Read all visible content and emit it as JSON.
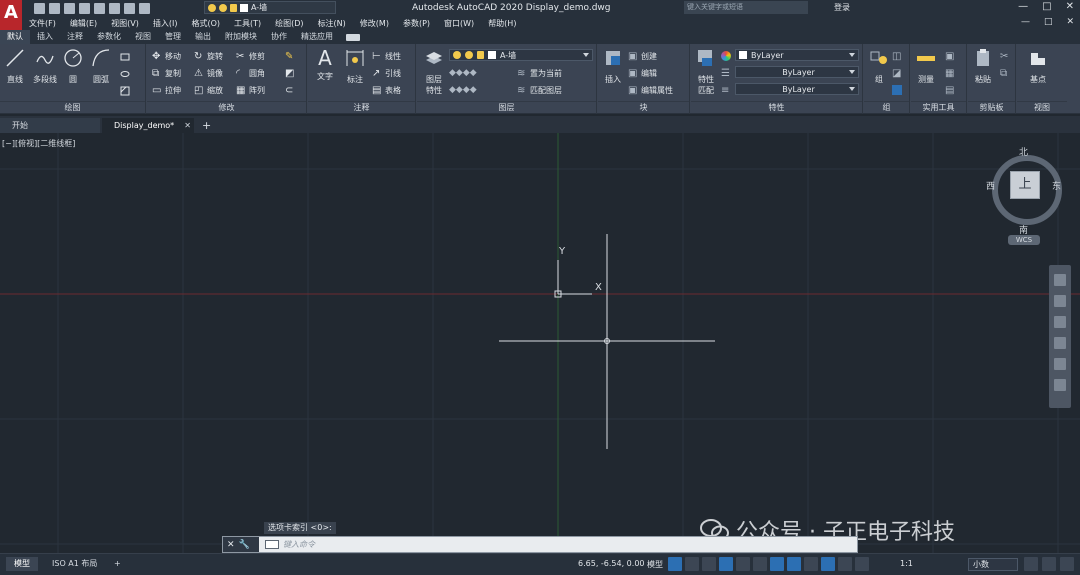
{
  "titlebar": {
    "app_logo": "A",
    "layer_name": "A-墙",
    "title": "Autodesk AutoCAD 2020    Display_demo.dwg",
    "search_placeholder": "键入关键字或短语",
    "login": "登录",
    "window_controls": [
      "—",
      "□",
      "✕"
    ]
  },
  "menubar": {
    "items": [
      "文件(F)",
      "编辑(E)",
      "视图(V)",
      "插入(I)",
      "格式(O)",
      "工具(T)",
      "绘图(D)",
      "标注(N)",
      "修改(M)",
      "参数(P)",
      "窗口(W)",
      "帮助(H)"
    ],
    "controls": [
      "—",
      "□",
      "✕"
    ]
  },
  "ribbon_tabs": [
    "默认",
    "插入",
    "注释",
    "参数化",
    "视图",
    "管理",
    "输出",
    "附加模块",
    "协作",
    "精选应用"
  ],
  "ribbon": {
    "draw": {
      "label": "绘图",
      "line": "直线",
      "polyline": "多段线",
      "circle": "圆",
      "arc": "圆弧"
    },
    "modify": {
      "label": "修改",
      "move": "移动",
      "rotate": "旋转",
      "trim": "修剪",
      "copy": "复制",
      "mirror": "镜像",
      "fillet": "圆角",
      "stretch": "拉伸",
      "scale": "缩放",
      "array": "阵列"
    },
    "annotation": {
      "label": "注释",
      "text": "文字",
      "dimension": "标注",
      "linear": "线性",
      "leader": "引线",
      "table": "表格"
    },
    "layers": {
      "label": "图层",
      "layer_props_1": "图层",
      "layer_props_2": "特性",
      "current_layer": "A-墙",
      "set_current": "置为当前",
      "match_layer": "匹配图层"
    },
    "block": {
      "label": "块",
      "insert": "插入",
      "create": "创建",
      "edit": "编辑",
      "edit_attr": "编辑属性"
    },
    "properties": {
      "label": "特性",
      "match_1": "特性",
      "match_2": "匹配",
      "color": "ByLayer",
      "linetype": "ByLayer",
      "lineweight": "ByLayer"
    },
    "groups": {
      "label": "组",
      "group": "组"
    },
    "utilities": {
      "label": "实用工具",
      "measure": "测量"
    },
    "clipboard": {
      "label": "剪贴板",
      "paste": "粘贴"
    },
    "view": {
      "label": "视图",
      "base": "基点"
    }
  },
  "file_tabs": {
    "start": "开始",
    "current": "Display_demo*",
    "close": "✕",
    "add": "+"
  },
  "canvas": {
    "viewport_label": "[−][俯视][二维线框]",
    "ucs_y": "Y",
    "ucs_x": "X"
  },
  "viewcube": {
    "north": "北",
    "south": "南",
    "east": "东",
    "west": "西",
    "face": "上",
    "wcs": "WCS"
  },
  "command": {
    "hint": "选项卡索引 <0>:",
    "placeholder": "键入命令"
  },
  "watermark": "公众号 · 子正电子科技",
  "statusbar": {
    "model_tab": "模型",
    "layout_tab": "ISO A1 布局",
    "add": "+",
    "coords": "6.65, -6.54, 0.00",
    "model": "模型",
    "scale": "1:1",
    "units": "小数"
  },
  "colors": {
    "background": "#212830",
    "grid_major": "#2c343f",
    "x_axis": "#7a2a2e",
    "y_axis": "#2c6a36",
    "crosshair": "#d9dde2",
    "accent": "#2c6fb3"
  }
}
